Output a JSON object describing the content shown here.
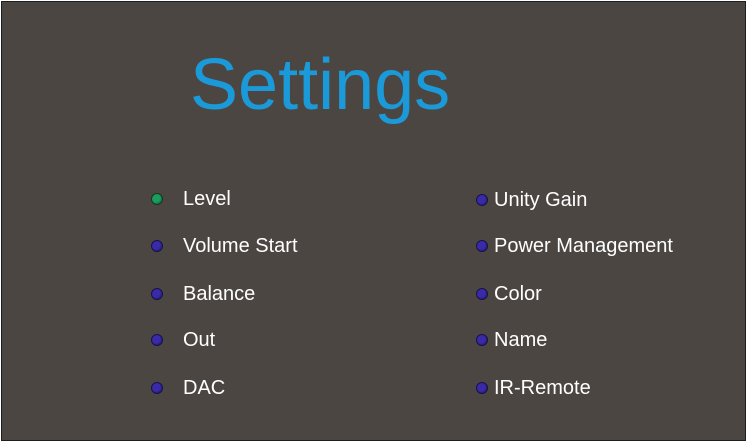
{
  "title": "Settings",
  "colors": {
    "background": "#4c4642",
    "title": "#1b9ad9",
    "selected_dot": "#1c9b5c",
    "unselected_dot": "#3b2aa8",
    "label": "#ffffff"
  },
  "menu": {
    "left": [
      {
        "label": "Level",
        "selected": true
      },
      {
        "label": "Volume Start",
        "selected": false
      },
      {
        "label": "Balance",
        "selected": false
      },
      {
        "label": "Out",
        "selected": false
      },
      {
        "label": "DAC",
        "selected": false
      }
    ],
    "right": [
      {
        "label": "Unity Gain",
        "selected": false
      },
      {
        "label": "Power Management",
        "selected": false
      },
      {
        "label": "Color",
        "selected": false
      },
      {
        "label": "Name",
        "selected": false
      },
      {
        "label": "IR-Remote",
        "selected": false
      }
    ]
  }
}
